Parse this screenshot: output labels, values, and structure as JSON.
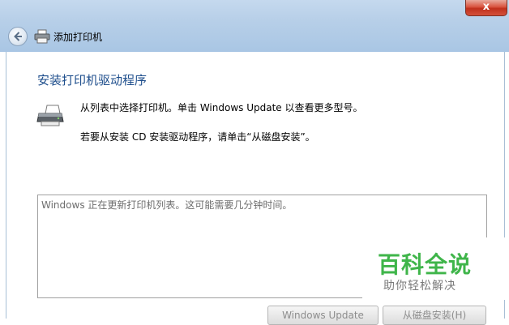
{
  "window": {
    "title": "添加打印机",
    "close_symbol": "x"
  },
  "page": {
    "heading": "安装打印机驱动程序",
    "instruction1": "从列表中选择打印机。单击 Windows Update 以查看更多型号。",
    "instruction2": "若要从安装 CD 安装驱动程序，请单击“从磁盘安装”。"
  },
  "list": {
    "status": "Windows 正在更新打印机列表。这可能需要几分钟时间。"
  },
  "buttons": {
    "windows_update": "Windows Update",
    "have_disk": "从磁盘安装(H)"
  },
  "watermark": {
    "title": "百科全说",
    "subtitle": "助你轻松解决"
  },
  "icons": {
    "back": "back-arrow-icon",
    "title": "printer-icon",
    "content": "printer-icon"
  }
}
